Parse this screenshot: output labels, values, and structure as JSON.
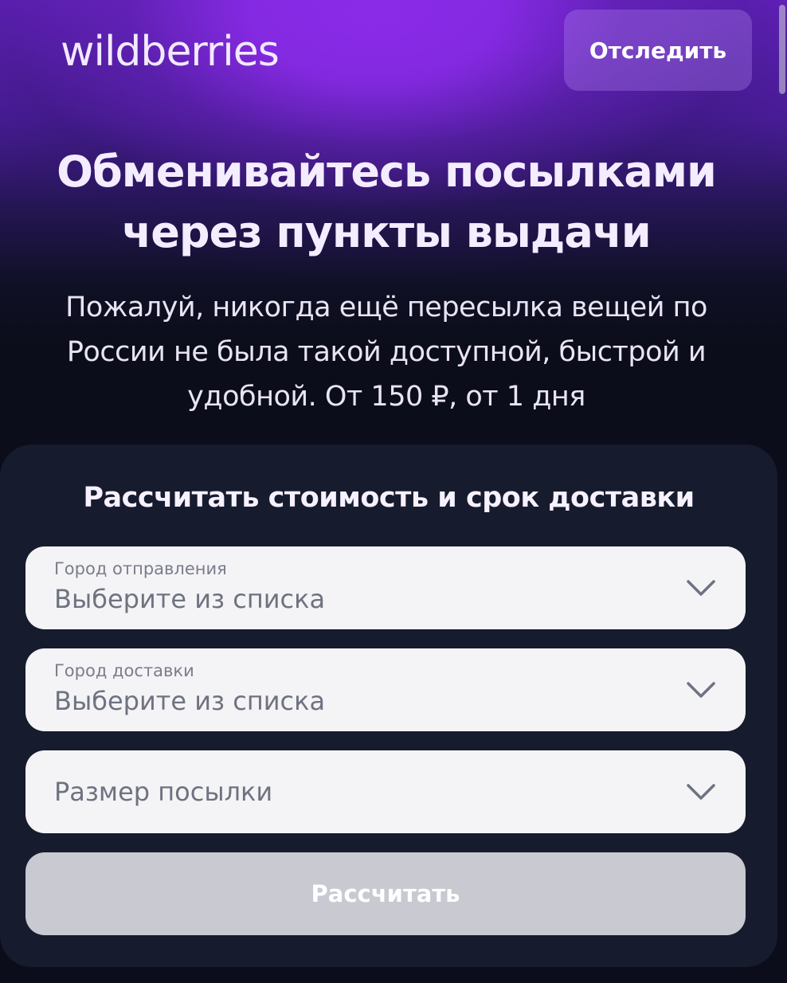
{
  "header": {
    "logo_text": "wildberries",
    "track_label": "Отследить"
  },
  "hero": {
    "headline_line1": "Обменивайтесь посылками",
    "headline_line2": "через пункты выдачи",
    "subtitle_line1": "Пожалуй, никогда ещё пересылка вещей по",
    "subtitle_line2": "России не была такой доступной, быстрой и",
    "subtitle_line3": "удобной. От 150 ₽, от 1 дня"
  },
  "calculator": {
    "title": "Рассчитать стоимость и срок доставки",
    "fields": [
      {
        "label": "Город отправления",
        "value": "Выберите из списка",
        "icon": "chevron-down-icon"
      },
      {
        "label": "Город доставки",
        "value": "Выберите из списка",
        "icon": "chevron-down-icon"
      },
      {
        "label": "",
        "value": "Размер посылки",
        "icon": "chevron-down-icon"
      }
    ],
    "submit_label": "Рассчитать"
  },
  "colors": {
    "brand_purple": "#8a2be8",
    "card_bg": "#171b2e",
    "field_bg": "#f4f4f7",
    "disabled_button": "#c8c9d1"
  }
}
